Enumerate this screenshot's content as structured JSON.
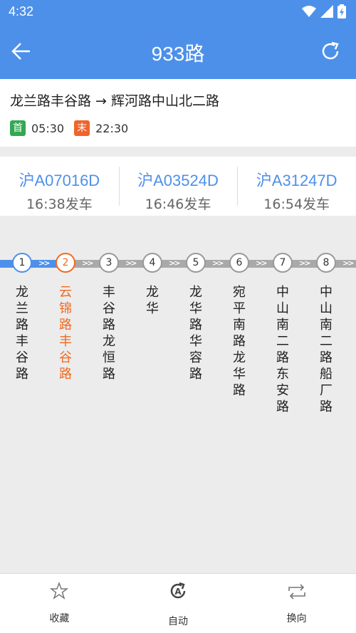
{
  "status_bar": {
    "time": "4:32"
  },
  "header": {
    "title": "933路"
  },
  "route": {
    "direction": "龙兰路丰谷路 → 辉河路中山北二路",
    "first_badge": "首",
    "first_time": "05:30",
    "last_badge": "末",
    "last_time": "22:30"
  },
  "buses": [
    {
      "plate": "沪A07016D",
      "departure": "16:38发车"
    },
    {
      "plate": "沪A03524D",
      "departure": "16:46发车"
    },
    {
      "plate": "沪A31247D",
      "departure": "16:54发车"
    }
  ],
  "stops": [
    {
      "num": "1",
      "name": "龙兰路丰谷路",
      "state": "done"
    },
    {
      "num": "2",
      "name": "云锦路丰谷路",
      "state": "current"
    },
    {
      "num": "3",
      "name": "丰谷路龙恒路",
      "state": "upcoming"
    },
    {
      "num": "4",
      "name": "龙华",
      "state": "upcoming"
    },
    {
      "num": "5",
      "name": "龙华路华容路",
      "state": "upcoming"
    },
    {
      "num": "6",
      "name": "宛平南路龙华路",
      "state": "upcoming"
    },
    {
      "num": "7",
      "name": "中山南二路东安路",
      "state": "upcoming"
    },
    {
      "num": "8",
      "name": "中山南二路船厂路",
      "state": "upcoming"
    }
  ],
  "bottom_nav": {
    "favorite": "收藏",
    "auto": "自动",
    "reverse": "换向"
  },
  "colors": {
    "primary": "#4d90ea",
    "current": "#f06a20",
    "first_badge": "#32a852",
    "last_badge": "#f0642c"
  }
}
